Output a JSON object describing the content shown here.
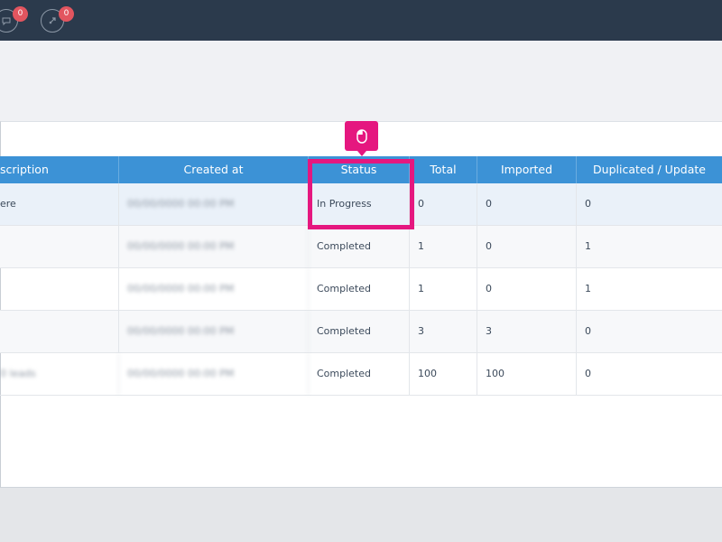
{
  "topbar": {
    "icons": [
      {
        "name": "chat-icon",
        "badge": "0"
      },
      {
        "name": "rocket-icon",
        "badge": "0"
      }
    ]
  },
  "table": {
    "headers": [
      "scription",
      "Created at",
      "Status",
      "Total",
      "Imported",
      "Duplicated / Update"
    ],
    "rows": [
      {
        "description": "ere",
        "created_at": "00/00/0000 00:00 PM",
        "status": "In Progress",
        "total": "0",
        "imported": "0",
        "duplicated": "0"
      },
      {
        "description": "",
        "created_at": "00/00/0000 00:00 PM",
        "status": "Completed",
        "total": "1",
        "imported": "0",
        "duplicated": "1"
      },
      {
        "description": "",
        "created_at": "00/00/0000 00:00 PM",
        "status": "Completed",
        "total": "1",
        "imported": "0",
        "duplicated": "1"
      },
      {
        "description": "",
        "created_at": "00/00/0000 00:00 PM",
        "status": "Completed",
        "total": "3",
        "imported": "3",
        "duplicated": "0"
      },
      {
        "description": "0 leads",
        "created_at": "00/00/0000 00:00 PM",
        "status": "Completed",
        "total": "100",
        "imported": "100",
        "duplicated": "0"
      }
    ]
  },
  "annotation": {
    "icon": "mouse-icon",
    "color": "#e5177f"
  }
}
